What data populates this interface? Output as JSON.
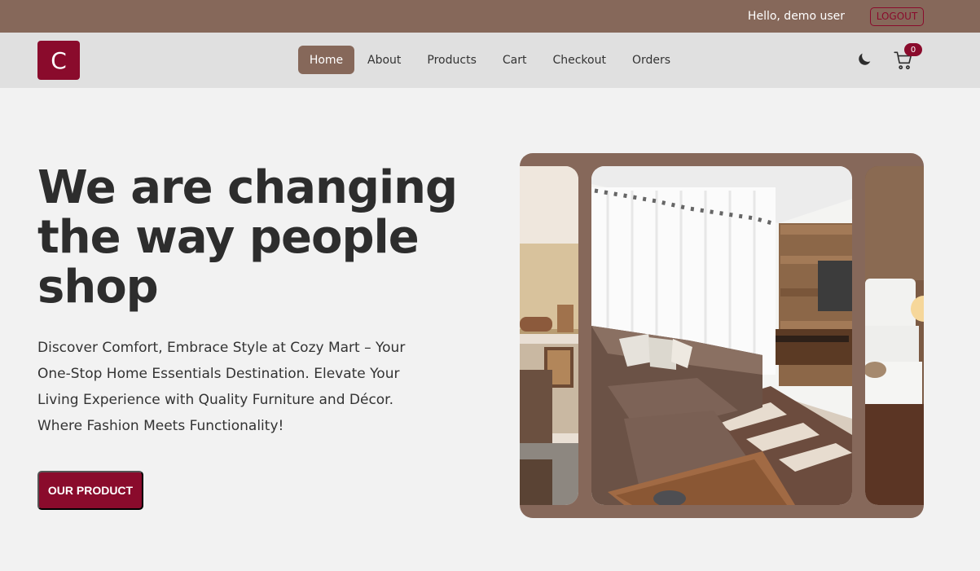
{
  "topbar": {
    "greeting": "Hello, demo user",
    "logout_label": "LOGOUT"
  },
  "navbar": {
    "logo_letter": "C",
    "links": [
      {
        "label": "Home",
        "active": true
      },
      {
        "label": "About"
      },
      {
        "label": "Products"
      },
      {
        "label": "Cart"
      },
      {
        "label": "Checkout"
      },
      {
        "label": "Orders"
      }
    ],
    "cart_count": "0",
    "theme_icon": "moon-icon",
    "cart_icon": "cart-icon"
  },
  "hero": {
    "title": "We are changing the way people shop",
    "description": "Discover Comfort, Embrace Style at Cozy Mart – Your One-Stop Home Essentials Destination. Elevate Your Living Experience with Quality Furniture and Décor. Where Fashion Meets Functionality!",
    "cta_label": "OUR PRODUCT"
  },
  "colors": {
    "brand": "#8a0b2c",
    "accent": "#86685a",
    "nav_bg": "#e0e0e0",
    "page_bg": "#f2f2f2"
  }
}
